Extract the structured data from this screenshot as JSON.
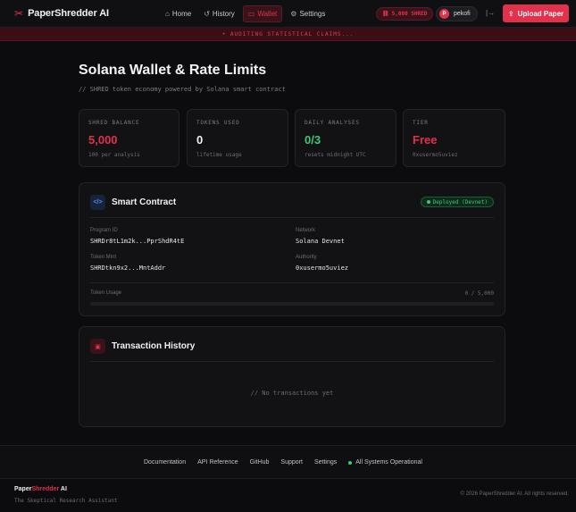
{
  "nav": {
    "brand_prefix": "PaperShredder",
    "brand_suffix": "AI",
    "links": [
      {
        "label": "Home",
        "icon": "home-icon"
      },
      {
        "label": "History",
        "icon": "history-icon"
      },
      {
        "label": "Wallet",
        "icon": "wallet-icon"
      },
      {
        "label": "Settings",
        "icon": "gear-icon"
      }
    ],
    "active": "Wallet",
    "shred_balance": "5,000 SHRED",
    "user_initial": "P",
    "username": "pekofi",
    "upload_label": "Upload Paper"
  },
  "banner": "• AUDITING STATISTICAL CLAIMS...",
  "page": {
    "title": "Solana Wallet & Rate Limits",
    "subtitle": "// SHRED token economy powered by Solana smart contract"
  },
  "stats": [
    {
      "label": "SHRED BALANCE",
      "value": "5,000",
      "note": "100 per analysis",
      "color": "#e3304b"
    },
    {
      "label": "TOKENS USED",
      "value": "0",
      "note": "lifetime usage",
      "color": "#f1f1f3"
    },
    {
      "label": "DAILY ANALYSES",
      "value": "0/3",
      "note": "resets midnight UTC",
      "color": "#3fc77a"
    },
    {
      "label": "TIER",
      "value": "Free",
      "note": "0xusermo5uviez",
      "color": "#e3304b"
    }
  ],
  "contract": {
    "icon_glyph": "</>",
    "title": "Smart Contract",
    "status": "Deployed (Devnet)",
    "program_id_label": "Program ID",
    "program_id": "SHRDr8tL1m2k...PprShdR4tE",
    "network_label": "Network",
    "network": "Solana Devnet",
    "token_mint_label": "Token Mint",
    "token_mint": "SHRDtkn9x2...MntAddr",
    "authority_label": "Authority",
    "authority": "0xusermo5uviez",
    "usage_label": "Token Usage",
    "usage_value": "0 / 5,000",
    "usage_fraction": 0
  },
  "transactions": {
    "title": "Transaction History",
    "empty": "// No transactions yet"
  },
  "footer": {
    "links": [
      "Documentation",
      "API Reference",
      "GitHub",
      "Support",
      "Settings"
    ],
    "status": "All Systems Operational",
    "brand_prefix": "Paper",
    "brand_mid": "Shredder",
    "brand_suffix": " AI",
    "tagline": "The Skeptical Research Assistant",
    "copyright": "© 2026 PaperShredder AI. All rights reserved."
  },
  "colors": {
    "accent": "#e3304b",
    "success": "#3fc77a",
    "background": "#0c0c0e"
  }
}
